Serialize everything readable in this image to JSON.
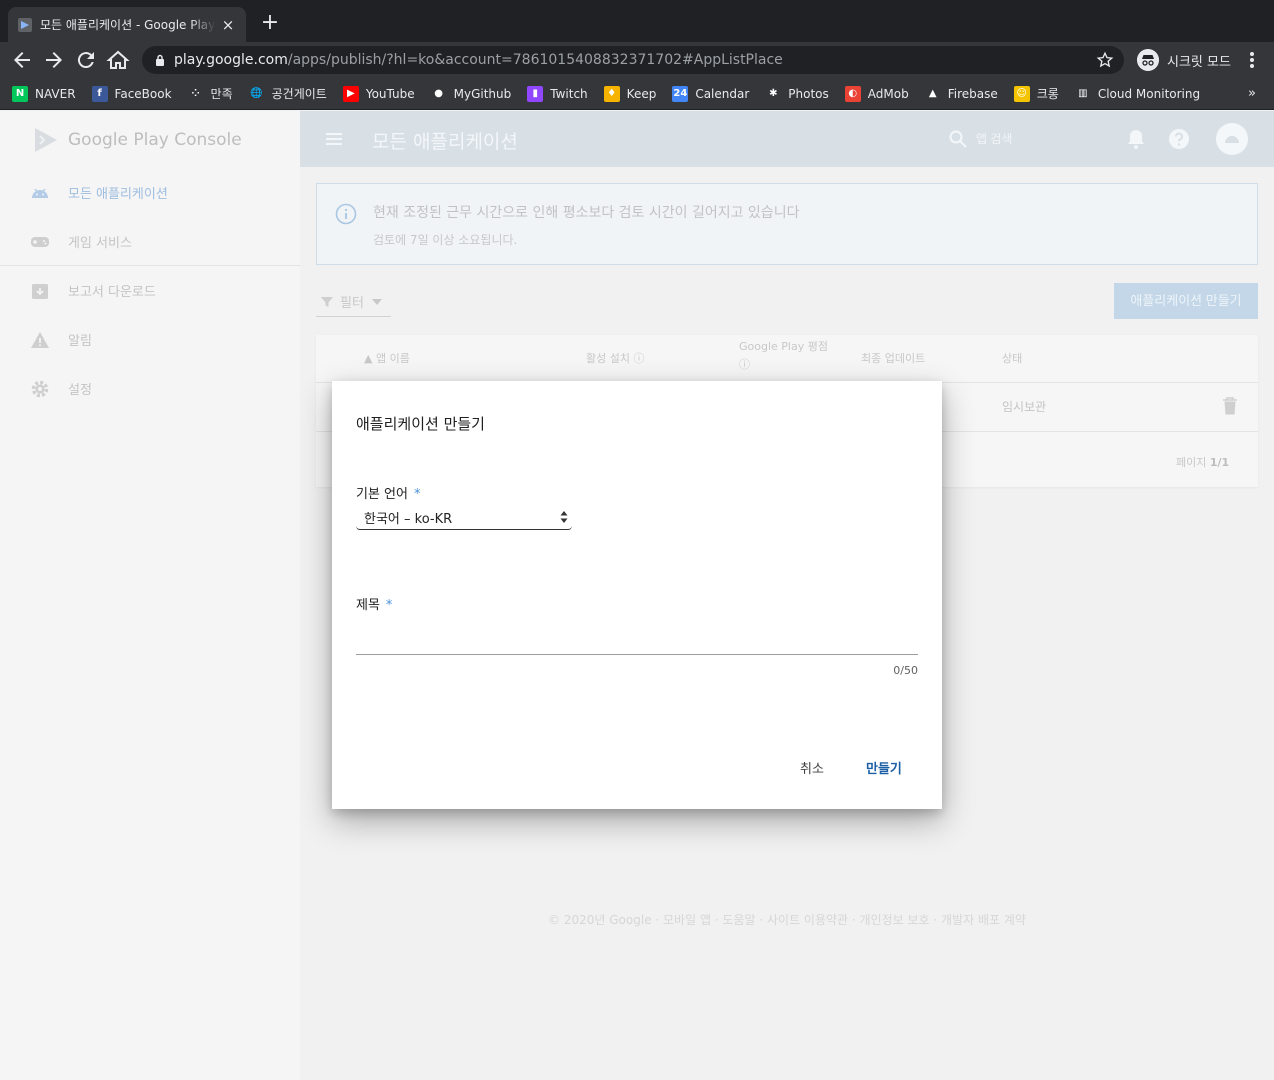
{
  "browser": {
    "tab_title": "모든 애플리케이션 - Google Play Console",
    "tab_close": "×",
    "new_tab": "+",
    "url_host": "play.google.com",
    "url_path": "/apps/publish/?hl=ko&account=7861015408832371702#AppListPlace",
    "incognito_label": "시크릿 모드",
    "bookmarks": [
      {
        "label": "NAVER",
        "icon": "naver-icon",
        "color": "#03c75a",
        "glyph": "N"
      },
      {
        "label": "FaceBook",
        "icon": "facebook-icon",
        "color": "#3b5998",
        "glyph": "f"
      },
      {
        "label": "만족",
        "icon": "dots-icon",
        "color": "#35363a",
        "glyph": "⁘"
      },
      {
        "label": "공건게이트",
        "icon": "globe-icon",
        "color": "#35363a",
        "glyph": "🌐"
      },
      {
        "label": "YouTube",
        "icon": "youtube-icon",
        "color": "#ff0000",
        "glyph": "▶"
      },
      {
        "label": "MyGithub",
        "icon": "github-icon",
        "color": "#35363a",
        "glyph": "●"
      },
      {
        "label": "Twitch",
        "icon": "twitch-icon",
        "color": "#9146ff",
        "glyph": "▮"
      },
      {
        "label": "Keep",
        "icon": "keep-icon",
        "color": "#f6b400",
        "glyph": "♦"
      },
      {
        "label": "Calendar",
        "icon": "calendar-icon",
        "color": "#4285f4",
        "glyph": "24"
      },
      {
        "label": "Photos",
        "icon": "photos-icon",
        "color": "#35363a",
        "glyph": "✱"
      },
      {
        "label": "AdMob",
        "icon": "admob-icon",
        "color": "#ea4335",
        "glyph": "◐"
      },
      {
        "label": "Firebase",
        "icon": "firebase-icon",
        "color": "#35363a",
        "glyph": "▲"
      },
      {
        "label": "크롱",
        "icon": "crong-icon",
        "color": "#f5c400",
        "glyph": "☺"
      },
      {
        "label": "Cloud Monitoring",
        "icon": "monitoring-icon",
        "color": "#35363a",
        "glyph": "▥"
      }
    ],
    "bookmarks_more": "»"
  },
  "app": {
    "logo_text": "Google Play Console",
    "page_title": "모든 애플리케이션",
    "search_placeholder": "앱 검색",
    "sidebar": [
      {
        "label": "모든 애플리케이션",
        "icon": "android-icon"
      },
      {
        "label": "게임 서비스",
        "icon": "gamepad-icon"
      },
      {
        "label": "보고서 다운로드",
        "icon": "download-report-icon"
      },
      {
        "label": "알림",
        "icon": "warning-icon"
      },
      {
        "label": "설정",
        "icon": "gear-icon"
      }
    ],
    "banner": {
      "heading": "현재 조정된 근무 시간으로 인해 평소보다 검토 시간이 길어지고 있습니다",
      "sub": "검토에 7일 이상 소요됩니다."
    },
    "filter_label": "필터",
    "create_button": "애플리케이션 만들기",
    "table": {
      "columns": [
        "앱 이름",
        "활성 설치",
        "Google Play 평점",
        "최종 업데이트",
        "상태"
      ],
      "rows": [
        {
          "status": "임시보관"
        }
      ],
      "pager_label": "페이지",
      "pager_value": "1/1"
    },
    "footer": "© 2020년 Google · 모바일 앱 · 도움말 · 사이트 이용약관 · 개인정보 보호 · 개발자 배포 계약"
  },
  "dialog": {
    "title": "애플리케이션 만들기",
    "language_label": "기본 언어",
    "language_value": "한국어 – ko-KR",
    "title_label": "제목",
    "required_mark": "*",
    "title_value": "",
    "counter": "0/50",
    "cancel": "취소",
    "create": "만들기"
  },
  "colors": {
    "accent": "#1d5fa6",
    "appbar": "#d8dfe5"
  }
}
